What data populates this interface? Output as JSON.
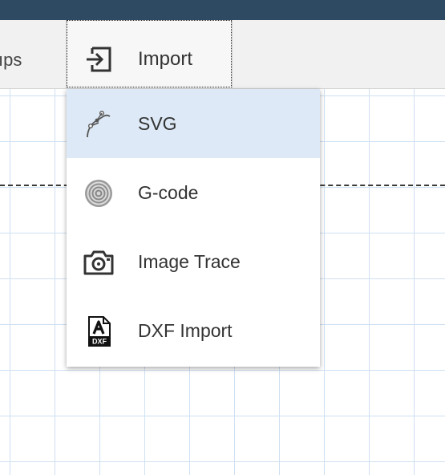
{
  "toolbar": {
    "partial_tab_label": "ıps",
    "import_label": "Import"
  },
  "import_menu": {
    "items": [
      {
        "label": "SVG",
        "icon": "bezier-pen-icon",
        "active": true
      },
      {
        "label": "G-code",
        "icon": "concentric-circles-icon",
        "active": false
      },
      {
        "label": "Image Trace",
        "icon": "camera-icon",
        "active": false
      },
      {
        "label": "DXF Import",
        "icon": "dxf-file-icon",
        "active": false
      }
    ]
  },
  "colors": {
    "top_bar": "#2e4a63",
    "toolbar_bg": "#f1f1f1",
    "active_item_bg": "#dde9f6",
    "grid_line": "#cfe0f2"
  }
}
